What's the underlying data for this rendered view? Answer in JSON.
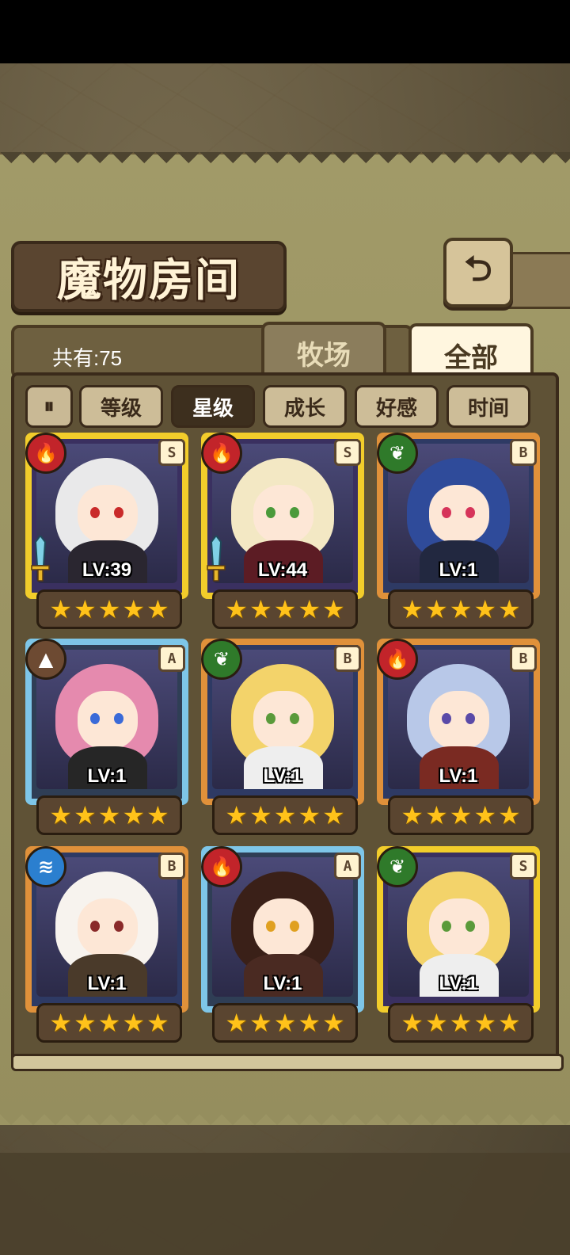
{
  "header": {
    "title": "魔物房间",
    "back_icon": "back-arrow-icon"
  },
  "summary": {
    "count_label": "共有:75"
  },
  "tabs": [
    {
      "label": "牧场",
      "active": false
    },
    {
      "label": "全部",
      "active": true
    }
  ],
  "sort": {
    "toggle_label": "⏸",
    "buttons": [
      {
        "label": "等级",
        "active": false
      },
      {
        "label": "星级",
        "active": true
      },
      {
        "label": "成长",
        "active": false
      },
      {
        "label": "好感",
        "active": false
      },
      {
        "label": "时间",
        "active": false
      }
    ]
  },
  "monsters": [
    {
      "level": "LV:39",
      "rank": "S",
      "element": "fire",
      "stars": 5,
      "frame": "gold",
      "equipped": true,
      "colors": {
        "hair": "#e9e9ea",
        "eye": "#c92a2a",
        "body": "#2a2630"
      }
    },
    {
      "level": "LV:44",
      "rank": "S",
      "element": "fire",
      "stars": 5,
      "frame": "gold",
      "equipped": true,
      "colors": {
        "hair": "#f3e8c4",
        "eye": "#4a9a3a",
        "body": "#5c1c24"
      }
    },
    {
      "level": "LV:1",
      "rank": "B",
      "element": "wood",
      "stars": 5,
      "frame": "bronze",
      "equipped": false,
      "colors": {
        "hair": "#2f4b9a",
        "eye": "#d6345a",
        "body": "#222840"
      }
    },
    {
      "level": "LV:1",
      "rank": "A",
      "element": "earth",
      "stars": 5,
      "frame": "blue",
      "equipped": false,
      "colors": {
        "hair": "#e58aae",
        "eye": "#3a6ad8",
        "body": "#262626"
      }
    },
    {
      "level": "LV:1",
      "rank": "B",
      "element": "wood",
      "stars": 5,
      "frame": "bronze",
      "equipped": false,
      "colors": {
        "hair": "#f3d36a",
        "eye": "#5a9a3a",
        "body": "#eeeeee"
      }
    },
    {
      "level": "LV:1",
      "rank": "B",
      "element": "fire",
      "stars": 5,
      "frame": "bronze",
      "equipped": false,
      "colors": {
        "hair": "#b8c8e8",
        "eye": "#5a4aa8",
        "body": "#7a2a22"
      }
    },
    {
      "level": "LV:1",
      "rank": "B",
      "element": "water",
      "stars": 5,
      "frame": "bronze",
      "equipped": false,
      "colors": {
        "hair": "#f7f3ee",
        "eye": "#8a2a2a",
        "body": "#4a3a2a"
      }
    },
    {
      "level": "LV:1",
      "rank": "A",
      "element": "fire",
      "stars": 5,
      "frame": "blue",
      "equipped": false,
      "colors": {
        "hair": "#3a2018",
        "eye": "#e0a020",
        "body": "#4a2a22"
      }
    },
    {
      "level": "LV:1",
      "rank": "S",
      "element": "wood",
      "stars": 5,
      "frame": "gold",
      "equipped": false,
      "colors": {
        "hair": "#f3d36a",
        "eye": "#5a9a3a",
        "body": "#eeeeee"
      }
    }
  ],
  "element_glyphs": {
    "fire": "🔥",
    "wood": "❦",
    "earth": "▲",
    "water": "≋"
  }
}
